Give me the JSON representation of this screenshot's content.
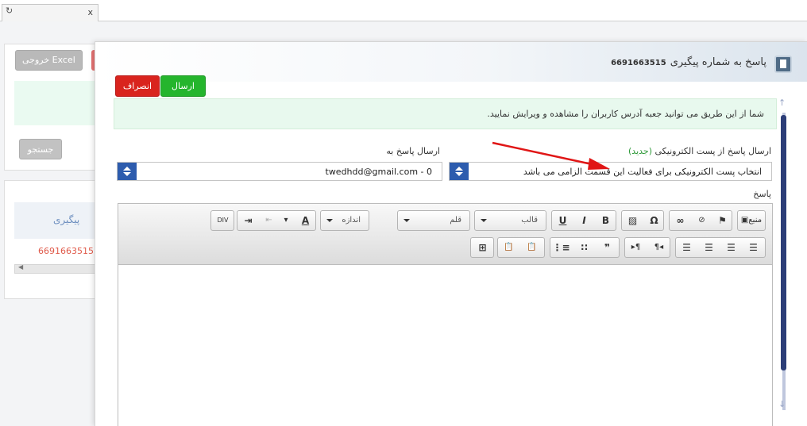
{
  "tab": {
    "close": "x"
  },
  "background": {
    "excel_button": "خروجی Excel",
    "search_button": "جستجو",
    "column_header": "پیگیری",
    "row_link": "6691663515"
  },
  "modal": {
    "title": "پاسخ به شماره پیگیری",
    "tracking_number": "6691663515",
    "send_button": "ارسال",
    "cancel_button": "انصراف",
    "info_text": "شما از این طریق می توانید جعبه آدرس کاربران را مشاهده و ویرایش نمایید.",
    "mail_label": "ارسال پاسخ از پست الکترونیکی",
    "mail_label_new": "(جدید)",
    "to_label": "ارسال پاسخ به",
    "mail_select_value": "انتخاب پست الکترونیکی برای فعالیت این قسمت الزامی می باشد",
    "to_select_value": "twedhdd@gmail.com - 0",
    "reply_label": "پاسخ"
  },
  "editor": {
    "source_label": "منبع",
    "format_dropdown": "قالب",
    "font_dropdown": "قلم",
    "size_dropdown": "اندازه",
    "bold": "B",
    "italic": "I",
    "underline": "U",
    "omega": "Ω",
    "textcolor": "A",
    "div": "DIV",
    "quote": "❞",
    "paragraph_rtl": "¶◂",
    "paragraph_ltr": "▸¶"
  },
  "colors": {
    "accent_blue": "#2d5cae",
    "send_green": "#25b52d",
    "cancel_red": "#d9241e",
    "info_bg": "#e8f9ee",
    "annotation_red": "#e01616"
  }
}
